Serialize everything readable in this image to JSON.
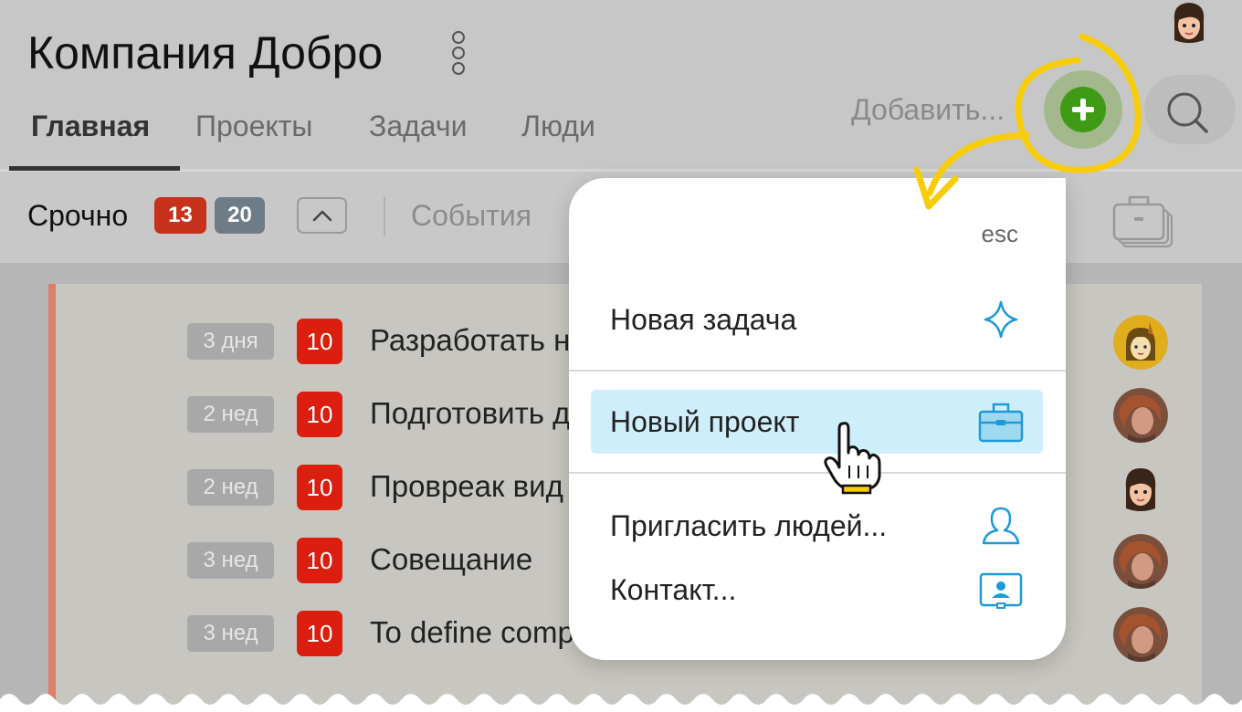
{
  "header": {
    "company_name": "Компания Добро",
    "more_icon": "kebab-menu-icon",
    "add_label": "Добавить...",
    "add_icon": "plus-circle-icon",
    "search_icon": "search-icon"
  },
  "tabs": [
    {
      "label": "Главная",
      "active": true
    },
    {
      "label": "Проекты",
      "active": false
    },
    {
      "label": "Задачи",
      "active": false
    },
    {
      "label": "Люди",
      "active": false
    }
  ],
  "toolbar": {
    "urgent_label": "Срочно",
    "urgent_count": "13",
    "other_count": "20",
    "collapse_icon": "chevron-up-icon",
    "events_label": "События",
    "projects_icon": "briefcase-stack-icon"
  },
  "tasks": [
    {
      "due": "3 дня",
      "priority": "10",
      "title": "Разработать н",
      "assignee_avatar": "avatar-yellow"
    },
    {
      "due": "2 нед",
      "priority": "10",
      "title": "Подготовить д",
      "assignee_avatar": "avatar-photo"
    },
    {
      "due": "2 нед",
      "priority": "10",
      "title": "Провреак вид",
      "assignee_avatar": "avatar-cartoon"
    },
    {
      "due": "3 нед",
      "priority": "10",
      "title": "Совещание",
      "assignee_avatar": "avatar-photo"
    },
    {
      "due": "3 нед",
      "priority": "10",
      "title": "To define comp",
      "assignee_avatar": "avatar-photo"
    }
  ],
  "dropdown": {
    "esc_label": "esc",
    "items": [
      {
        "label": "Новая задача",
        "icon": "sparkle-icon"
      },
      {
        "label": "Новый проект",
        "icon": "briefcase-icon",
        "highlighted": true
      },
      {
        "label": "Пригласить людей...",
        "icon": "person-icon"
      },
      {
        "label": "Контакт...",
        "icon": "contact-card-icon"
      }
    ]
  },
  "colors": {
    "accent_green": "#3f9a16",
    "urgent_red": "#c6321b",
    "count_gray": "#6e7c88",
    "priority_red": "#db1e0e",
    "menu_highlight": "#cfeefb",
    "icon_blue": "#1e9ad6",
    "annotation_yellow": "#f7cd0b"
  }
}
